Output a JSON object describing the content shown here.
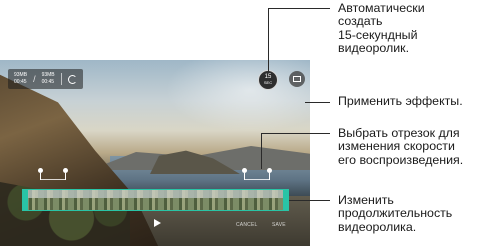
{
  "screen": {
    "info": {
      "size_left": "93MB",
      "time_left": "00:45",
      "size_right": "93MB",
      "time_right": "00:45"
    },
    "auto_button": {
      "number": "15",
      "unit": "SEC"
    },
    "bottom_bar": {
      "cancel_label": "CANCEL",
      "save_label": "SAVE"
    },
    "accent_color": "#29c4a6"
  },
  "callouts": [
    {
      "lines": [
        "Автоматически",
        "создать",
        "15-секундный",
        "видеоролик."
      ]
    },
    {
      "lines": [
        "Применить эффекты."
      ]
    },
    {
      "lines": [
        "Выбрать отрезок для",
        "изменения скорости",
        "его воспроизведения."
      ]
    },
    {
      "lines": [
        "Изменить",
        "продолжительность",
        "видеоролика."
      ]
    }
  ]
}
